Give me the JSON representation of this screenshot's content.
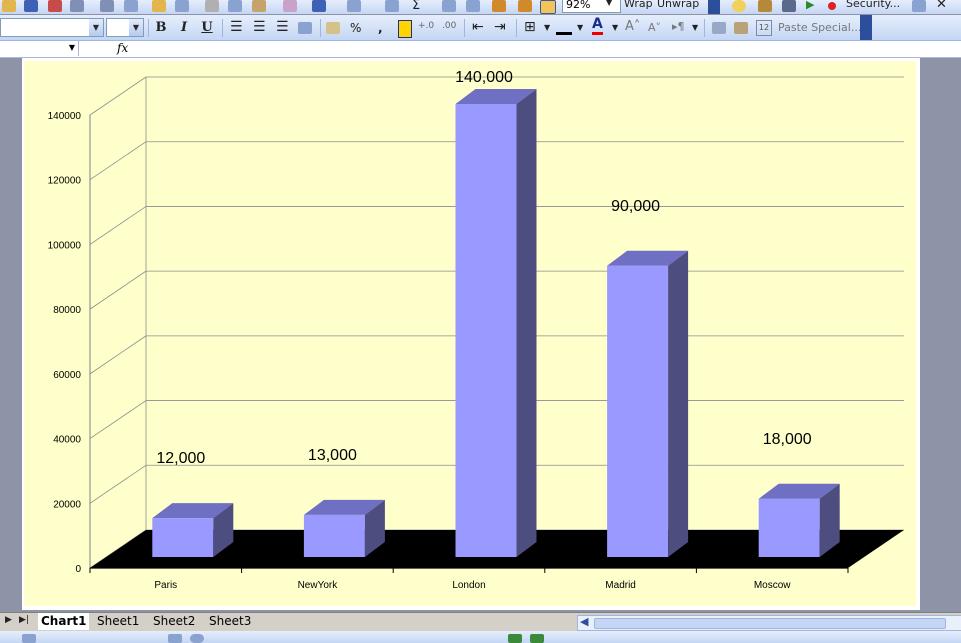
{
  "toolbar": {
    "zoom": "92%",
    "wrap_label": "Wrap",
    "unwrap_label": "Unwrap",
    "security_label": "Security...",
    "bold": "B",
    "italic": "I",
    "underline": "U",
    "percent": "%",
    "comma": ",",
    "font_color_letter": "A",
    "paste_special_label": "Paste Special...",
    "paste_special_count": "12"
  },
  "formula_bar": {
    "fx": "fx",
    "name_box": "",
    "content": ""
  },
  "sheet_tabs": [
    "Chart1",
    "Sheet1",
    "Sheet2",
    "Sheet3"
  ],
  "active_tab": "Chart1",
  "colors": {
    "chart_area": "#ffffcc",
    "bar_front": "#9999ff",
    "bar_top": "#6f6fc4",
    "bar_side": "#4d4d80",
    "floor": "#000000",
    "toolbar": "#c4d6f4"
  },
  "chart_data": {
    "type": "bar",
    "style": "3d-column",
    "categories": [
      "Paris",
      "NewYork",
      "London",
      "Madrid",
      "Moscow"
    ],
    "values": [
      12000,
      13000,
      140000,
      90000,
      18000
    ],
    "data_labels": [
      "12,000",
      "13,000",
      "140,000",
      "90,000",
      "18,000"
    ],
    "y_ticks": [
      "0",
      "20000",
      "40000",
      "60000",
      "80000",
      "100000",
      "120000",
      "140000"
    ],
    "ylim": [
      0,
      140000
    ],
    "grid": true,
    "legend": "none"
  }
}
